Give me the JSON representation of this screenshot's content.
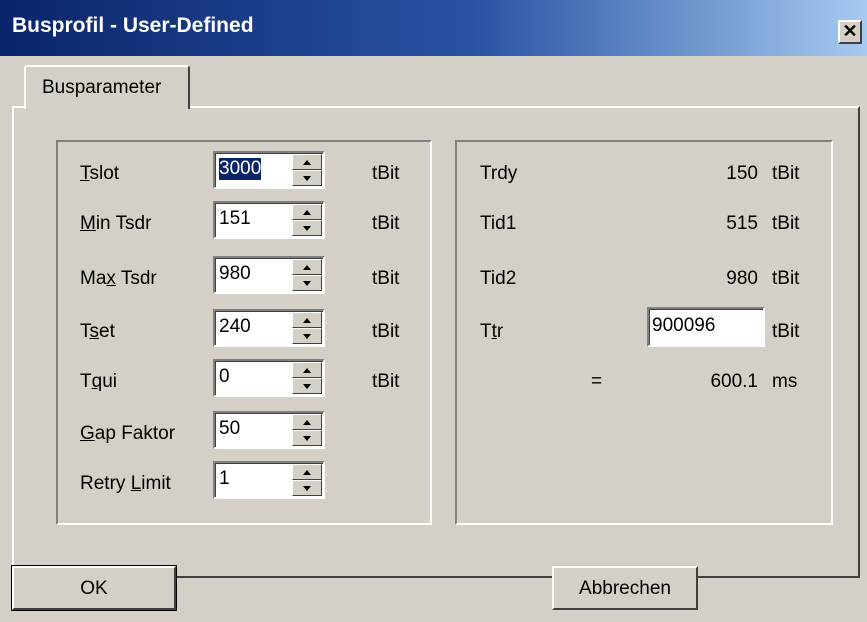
{
  "window": {
    "title": "Busprofil - User-Defined",
    "close_glyph": "✕"
  },
  "tabs": [
    {
      "label": "Busparameter",
      "active": true
    }
  ],
  "left_params": [
    {
      "name": "Tslot",
      "value": "3000",
      "unit": "tBit",
      "selected": true
    },
    {
      "name": "Min Tsdr",
      "value": "151",
      "unit": "tBit"
    },
    {
      "name": "Max Tsdr",
      "value": "980",
      "unit": "tBit"
    },
    {
      "name": "Tset",
      "value": "240",
      "unit": "tBit"
    },
    {
      "name": "Tqui",
      "value": "0",
      "unit": "tBit"
    },
    {
      "name": "Gap Faktor",
      "value": "50",
      "unit": ""
    },
    {
      "name": "Retry Limit",
      "value": "1",
      "unit": ""
    }
  ],
  "right_params": {
    "trdy": {
      "name": "Trdy",
      "value": "150",
      "unit": "tBit"
    },
    "tid1": {
      "name": "Tid1",
      "value": "515",
      "unit": "tBit"
    },
    "tid2": {
      "name": "Tid2",
      "value": "980",
      "unit": "tBit"
    },
    "ttr": {
      "name": "Ttr",
      "value": "900096",
      "unit": "tBit"
    },
    "result": {
      "eq": "=",
      "value": "600.1",
      "unit": "ms"
    }
  },
  "buttons": {
    "ok": "OK",
    "cancel": "Abbrechen"
  },
  "colors": {
    "titlebar": "#0a246a",
    "face": "#d4d0c8"
  }
}
